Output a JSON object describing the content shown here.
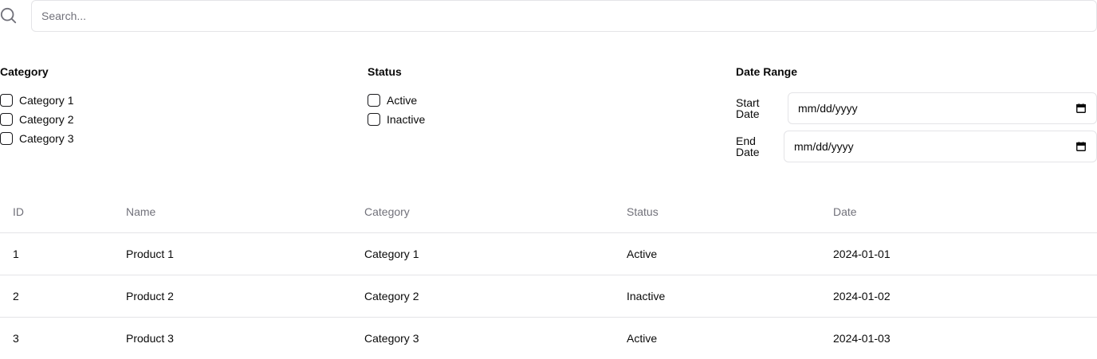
{
  "search": {
    "placeholder": "Search...",
    "value": "",
    "icon": "search-icon"
  },
  "filters": {
    "category": {
      "title": "Category",
      "options": [
        {
          "label": "Category 1",
          "checked": false
        },
        {
          "label": "Category 2",
          "checked": false
        },
        {
          "label": "Category 3",
          "checked": false
        }
      ]
    },
    "status": {
      "title": "Status",
      "options": [
        {
          "label": "Active",
          "checked": false
        },
        {
          "label": "Inactive",
          "checked": false
        }
      ]
    },
    "date_range": {
      "title": "Date Range",
      "start": {
        "label": "Start Date",
        "value": "mm/dd/yyyy",
        "icon": "calendar-icon"
      },
      "end": {
        "label": "End Date",
        "value": "mm/dd/yyyy",
        "icon": "calendar-icon"
      }
    }
  },
  "table": {
    "columns": [
      "ID",
      "Name",
      "Category",
      "Status",
      "Date"
    ],
    "rows": [
      [
        "1",
        "Product 1",
        "Category 1",
        "Active",
        "2024-01-01"
      ],
      [
        "2",
        "Product 2",
        "Category 2",
        "Inactive",
        "2024-01-02"
      ],
      [
        "3",
        "Product 3",
        "Category 3",
        "Active",
        "2024-01-03"
      ]
    ]
  },
  "colors": {
    "border": "#e4e4e7",
    "muted_text": "#71717a",
    "text": "#0a0a0a"
  }
}
